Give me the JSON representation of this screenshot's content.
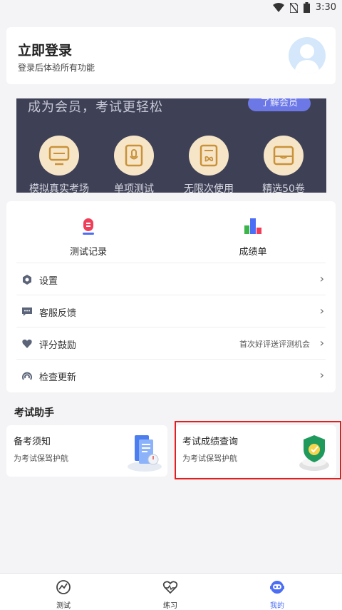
{
  "status_bar": {
    "time": "3:30"
  },
  "login": {
    "title": "立即登录",
    "subtitle": "登录后体验所有功能"
  },
  "banner": {
    "title": "成为会员，考试更轻松",
    "button": "了解会员",
    "features": [
      {
        "label": "模拟真实考场",
        "icon": "monitor-icon"
      },
      {
        "label": "单项测试",
        "icon": "microphone-doc-icon"
      },
      {
        "label": "无限次使用",
        "icon": "infinity-doc-icon"
      },
      {
        "label": "精选50卷",
        "icon": "inbox-tray-icon"
      }
    ]
  },
  "records": [
    {
      "label": "测试记录",
      "icon": "test-record-icon"
    },
    {
      "label": "成绩单",
      "icon": "bar-chart-icon"
    }
  ],
  "menu": [
    {
      "label": "设置",
      "note": "",
      "icon": "gear-icon"
    },
    {
      "label": "客服反馈",
      "note": "",
      "icon": "chat-bubble-icon"
    },
    {
      "label": "评分鼓励",
      "note": "首次好评送评测机会",
      "icon": "heart-icon"
    },
    {
      "label": "检查更新",
      "note": "",
      "icon": "update-icon"
    }
  ],
  "section_title": "考试助手",
  "helpers": [
    {
      "title": "备考须知",
      "subtitle": "为考试保驾护航"
    },
    {
      "title": "考试成绩查询",
      "subtitle": "为考试保驾护航"
    }
  ],
  "tabs": [
    {
      "label": "测试",
      "icon": "chart-circle-icon",
      "active": false
    },
    {
      "label": "练习",
      "icon": "heart-pulse-icon",
      "active": false
    },
    {
      "label": "我的",
      "icon": "robot-face-icon",
      "active": true
    }
  ],
  "colors": {
    "accent": "#4c6ef5",
    "banner_bg": "#3e4056",
    "gold": "#f6e5c7",
    "highlight": "#e02020"
  }
}
